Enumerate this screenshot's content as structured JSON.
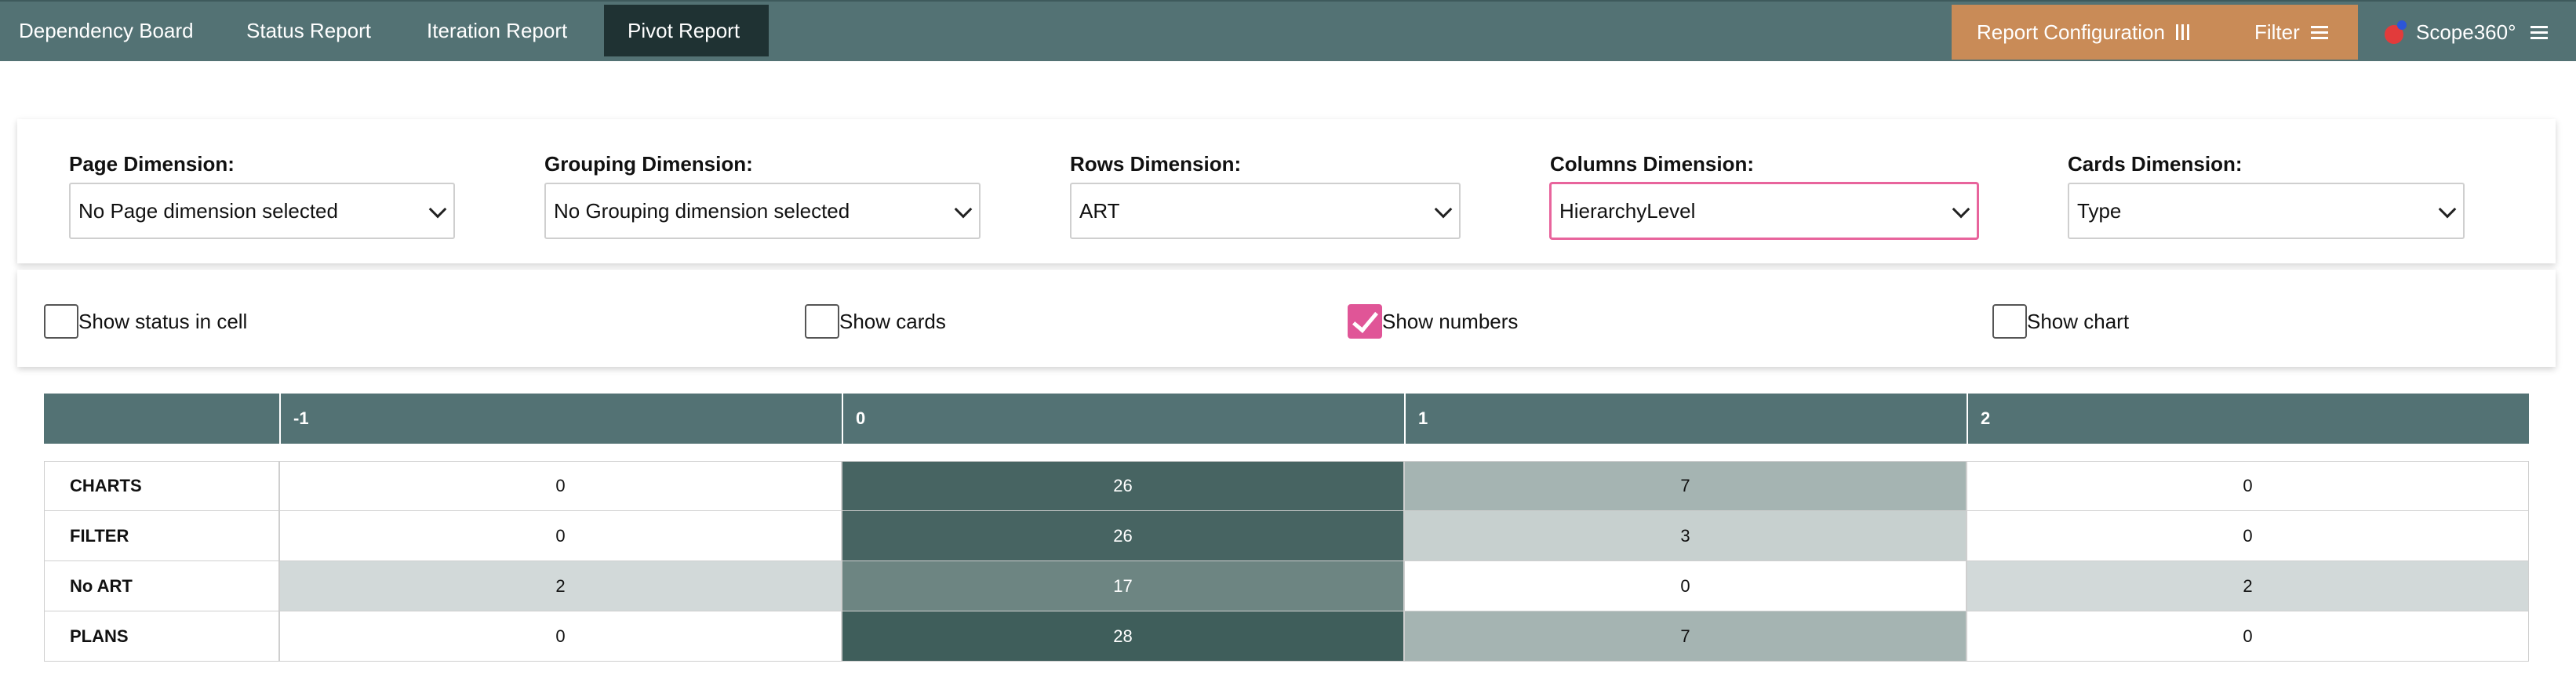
{
  "nav": {
    "tabs": [
      {
        "label": "Dependency Board"
      },
      {
        "label": "Status Report"
      },
      {
        "label": "Iteration Report"
      },
      {
        "label": "Pivot Report"
      }
    ],
    "active_tab": "Pivot Report",
    "report_configuration_label": "Report Configuration",
    "filter_label": "Filter",
    "brand_label": "Scope360°"
  },
  "dimensions": {
    "page": {
      "label": "Page Dimension:",
      "value": "No Page dimension selected"
    },
    "grouping": {
      "label": "Grouping Dimension:",
      "value": "No Grouping dimension selected"
    },
    "rows": {
      "label": "Rows Dimension:",
      "value": "ART"
    },
    "columns": {
      "label": "Columns Dimension:",
      "value": "HierarchyLevel"
    },
    "cards": {
      "label": "Cards Dimension:",
      "value": "Type"
    }
  },
  "options": [
    {
      "label": "Show status in cell",
      "checked": false
    },
    {
      "label": "Show cards",
      "checked": false
    },
    {
      "label": "Show numbers",
      "checked": true
    },
    {
      "label": "Show chart",
      "checked": false
    }
  ],
  "pivot": {
    "column_headers": [
      "",
      "-1",
      "0",
      "1",
      "2"
    ],
    "rows": [
      {
        "label": "CHARTS",
        "values": [
          "0",
          "26",
          "7",
          "0"
        ]
      },
      {
        "label": "FILTER",
        "values": [
          "0",
          "26",
          "3",
          "0"
        ]
      },
      {
        "label": "No ART",
        "values": [
          "2",
          "17",
          "0",
          "2"
        ]
      },
      {
        "label": "PLANS",
        "values": [
          "0",
          "28",
          "7",
          "0"
        ]
      }
    ],
    "max_value": 28
  },
  "colors": {
    "nav_bg": "#537274",
    "active_tab_bg": "#1f3233",
    "config_bg": "#c98b57",
    "accent_pink": "#e05597",
    "heat_dark": "#3f5e5b"
  }
}
